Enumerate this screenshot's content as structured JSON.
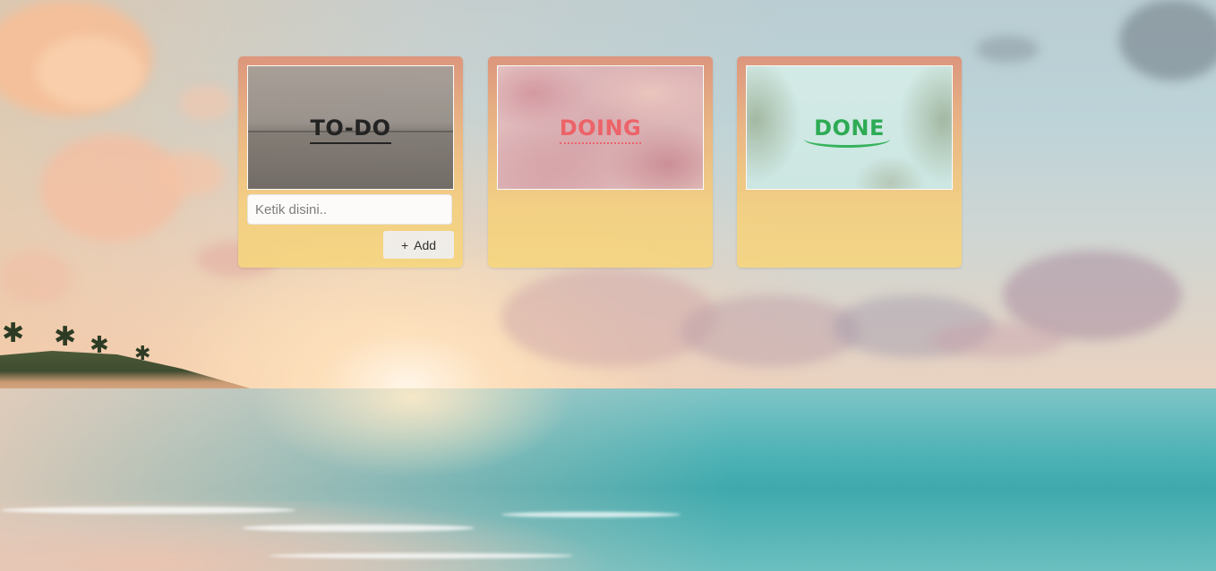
{
  "board": {
    "columns": [
      {
        "id": "todo",
        "banner_title": "TO-DO"
      },
      {
        "id": "doing",
        "banner_title": "DOING"
      },
      {
        "id": "done",
        "banner_title": "DONE"
      }
    ],
    "todo_form": {
      "placeholder": "Ketik disini..",
      "value": "",
      "add_icon": "+",
      "add_label": "Add"
    }
  },
  "colors": {
    "column_top": "#df9277",
    "column_bottom": "#f6d680",
    "todo_title": "#151515",
    "doing_title": "#f05a5f",
    "done_title": "#22a84a"
  },
  "icons": {
    "add_button_icon": "plus-icon"
  }
}
